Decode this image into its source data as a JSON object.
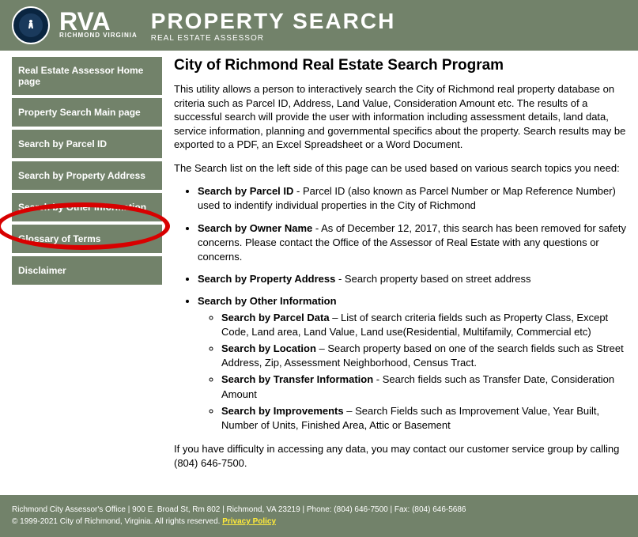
{
  "header": {
    "logo_text": "RVA",
    "logo_sub": "RICHMOND VIRGINIA",
    "title": "PROPERTY SEARCH",
    "subtitle": "REAL ESTATE ASSESSOR"
  },
  "sidebar": {
    "items": [
      "Real Estate Assessor Home page",
      "Property Search Main page",
      "Search by Parcel ID",
      "Search by Property Address",
      "Search by Other Information",
      "Glossary of Terms",
      "Disclaimer"
    ]
  },
  "content": {
    "heading": "City of Richmond Real Estate Search Program",
    "p1": "This utility allows a person to interactively search the City of Richmond real property database on criteria such as Parcel ID, Address, Land Value, Consideration Amount etc. The results of a successful search will provide the user with information including assessment details, land data, service information, planning and governmental specifics about the property. Search results may be exported to a PDF, an Excel Spreadsheet or a Word Document.",
    "p2": "The Search list on the left side of this page can be used based on various search topics you need:",
    "bullets": {
      "b1_label": "Search by Parcel ID",
      "b1_text": " - Parcel ID (also known as Parcel Number or Map Reference Number) used to indentify individual properties in the City of Richmond",
      "b2_label": "Search by Owner Name",
      "b2_text": " - As of December 12, 2017, this search has been removed for safety concerns. Please contact the Office of the Assessor of Real Estate with any questions or concerns.",
      "b3_label": "Search by Property Address",
      "b3_text": " - Search property based on street address",
      "b4_label": "Search by Other Information",
      "sub": {
        "s1_label": "Search by Parcel Data",
        "s1_text": " – List of search criteria fields such as Property Class, Except Code, Land area, Land Value, Land use(Residential, Multifamily, Commercial etc)",
        "s2_label": "Search by Location",
        "s2_text": " – Search property based on one of the search fields such as Street Address, Zip, Assessment Neighborhood, Census Tract.",
        "s3_label": "Search by Transfer Information",
        "s3_text": " - Search fields such as Transfer Date, Consideration Amount",
        "s4_label": "Search by Improvements",
        "s4_text": " – Search Fields such as Improvement Value, Year Built, Number of Units, Finished Area, Attic or Basement"
      }
    },
    "p3": "If you have difficulty in accessing any data, you may contact our customer service group by calling (804) 646-7500."
  },
  "footer": {
    "line1": "Richmond City Assessor's Office | 900 E. Broad St, Rm 802 | Richmond, VA 23219 | Phone: (804) 646-7500 | Fax: (804) 646-5686",
    "line2a": "© 1999-2021 City of Richmond, Virginia. All rights reserved. ",
    "privacy": "Privacy Policy"
  }
}
